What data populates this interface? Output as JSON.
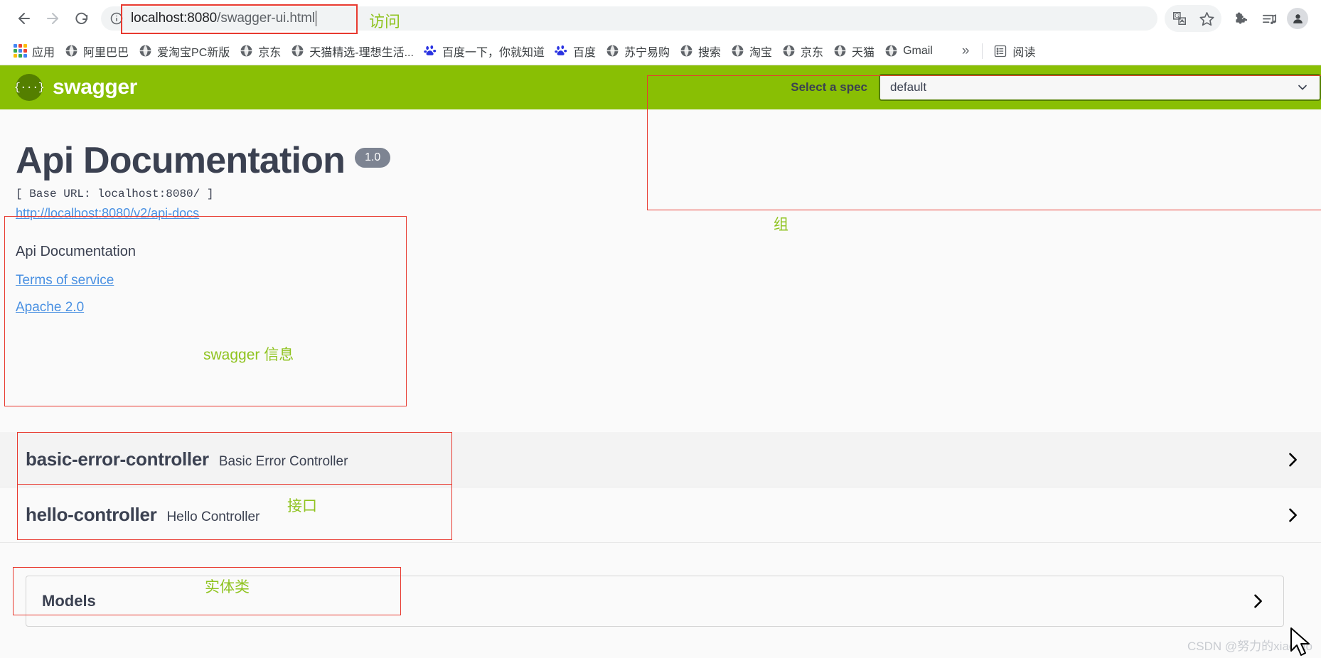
{
  "browser": {
    "back_label": "Back",
    "forward_label": "Forward",
    "reload_label": "Reload",
    "url_host": "localhost:8080",
    "url_path": "/swagger-ui.html",
    "url_full": "localhost:8080/swagger-ui.html",
    "annotation_visit": "访问",
    "icons": {
      "back": "back-arrow-icon",
      "forward": "forward-arrow-icon",
      "reload": "reload-icon",
      "info": "info-circle-icon",
      "translate": "translate-icon",
      "bookmark": "star-icon",
      "extensions": "puzzle-piece-icon",
      "media": "media-list-icon",
      "profile": "profile-avatar-icon"
    }
  },
  "bookmarks": {
    "items": [
      {
        "label": "应用",
        "icon": "apps-grid-icon"
      },
      {
        "label": "阿里巴巴",
        "icon": "globe-icon"
      },
      {
        "label": "爱淘宝PC新版",
        "icon": "globe-icon"
      },
      {
        "label": "京东",
        "icon": "globe-icon"
      },
      {
        "label": "天猫精选-理想生活...",
        "icon": "globe-icon"
      },
      {
        "label": "百度一下，你就知道",
        "icon": "baidu-icon"
      },
      {
        "label": "百度",
        "icon": "baidu-icon"
      },
      {
        "label": "苏宁易购",
        "icon": "globe-icon"
      },
      {
        "label": "搜索",
        "icon": "globe-icon"
      },
      {
        "label": "淘宝",
        "icon": "globe-icon"
      },
      {
        "label": "京东",
        "icon": "globe-icon"
      },
      {
        "label": "天猫",
        "icon": "globe-icon"
      },
      {
        "label": "Gmail",
        "icon": "globe-icon"
      }
    ],
    "overflow_label": "»",
    "reading_list_label": "阅读",
    "reading_list_icon": "reading-list-icon"
  },
  "swagger": {
    "brand": "swagger",
    "logo_glyph": "{···}",
    "topbar_color": "#89bf04",
    "spec": {
      "label": "Select a spec",
      "selected": "default",
      "chevron_icon": "chevron-down-icon"
    },
    "info": {
      "title": "Api Documentation",
      "version": "1.0",
      "base_url": "[ Base URL: localhost:8080/ ]",
      "api_docs_url": "http://localhost:8080/v2/api-docs",
      "description": "Api Documentation",
      "terms_label": "Terms of service",
      "license_label": "Apache 2.0"
    },
    "tags": [
      {
        "name": "basic-error-controller",
        "description": "Basic Error Controller",
        "chevron_icon": "chevron-right-icon"
      },
      {
        "name": "hello-controller",
        "description": "Hello Controller",
        "chevron_icon": "chevron-right-icon"
      }
    ],
    "models": {
      "title": "Models",
      "chevron_icon": "chevron-right-icon"
    }
  },
  "annotations": {
    "visit": "访问",
    "group": "组",
    "swagger_info": "swagger 信息",
    "interface": "接口",
    "entity_class": "实体类",
    "color_green": "#8fc31f",
    "color_red": "#e83a30"
  },
  "watermark": {
    "text": "CSDN @努力的xiaotao"
  }
}
